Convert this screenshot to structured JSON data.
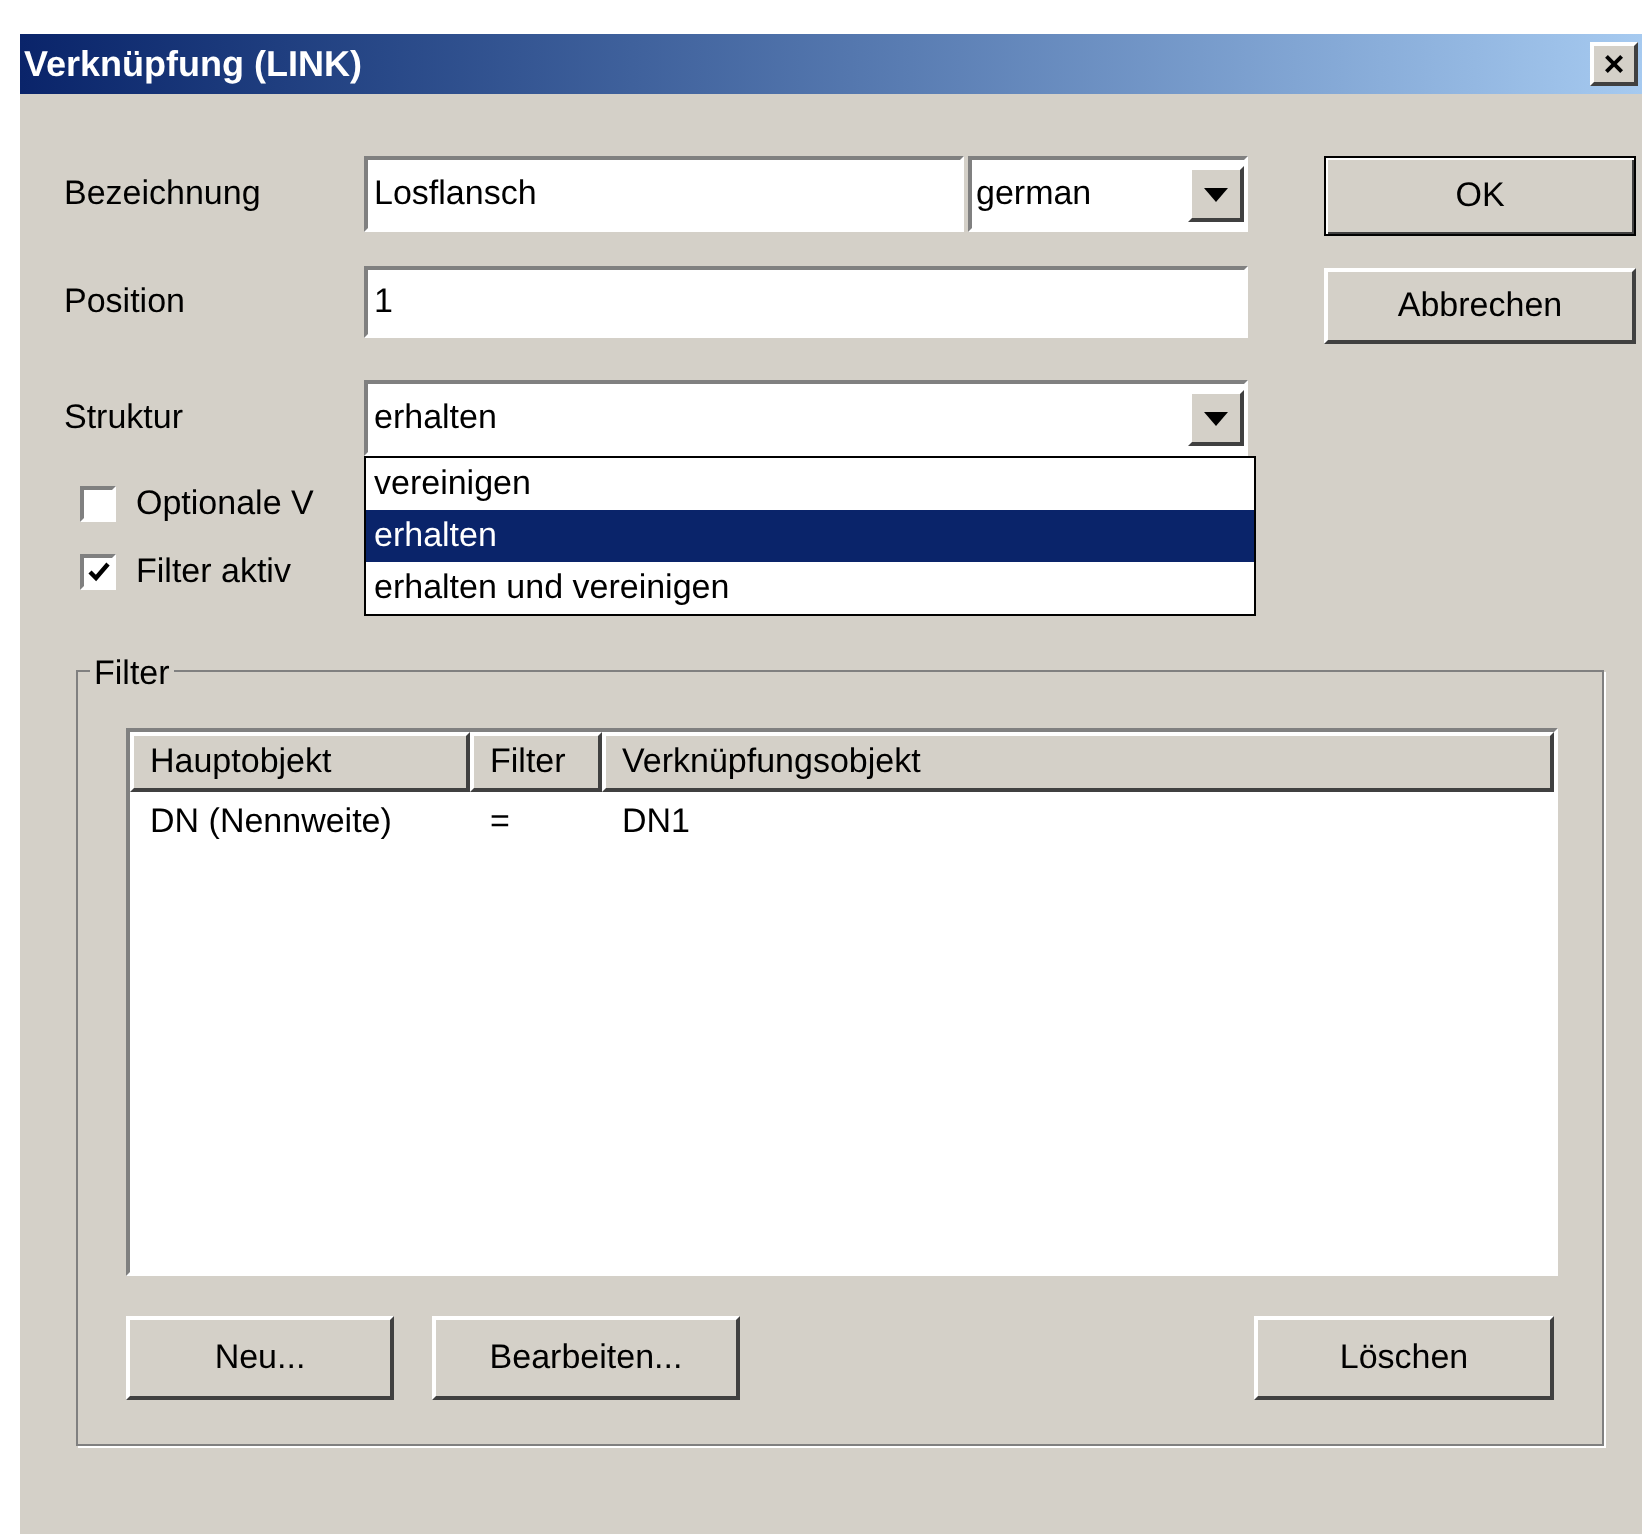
{
  "window": {
    "title": "Verknüpfung (LINK)",
    "close": "×"
  },
  "fields": {
    "bezeichnung": {
      "label": "Bezeichnung",
      "value": "Losflansch",
      "language": "german"
    },
    "position": {
      "label": "Position",
      "value": "1"
    },
    "struktur": {
      "label": "Struktur",
      "value": "erhalten"
    }
  },
  "struktur_options": [
    {
      "label": "vereinigen",
      "selected": false
    },
    {
      "label": "erhalten",
      "selected": true
    },
    {
      "label": "erhalten und vereinigen",
      "selected": false
    }
  ],
  "checkboxes": [
    {
      "label": "Optionale V",
      "checked": false
    },
    {
      "label": "Filter aktiv",
      "checked": true
    }
  ],
  "buttons": {
    "ok": "OK",
    "cancel": "Abbrechen"
  },
  "filter": {
    "title": "Filter",
    "columns": [
      "Hauptobjekt",
      "Filter",
      "Verknüpfungsobjekt"
    ],
    "rows": [
      [
        "DN (Nennweite)",
        "=",
        "DN1"
      ]
    ],
    "buttons": [
      "Neu...",
      "Bearbeiten...",
      "Löschen"
    ]
  }
}
